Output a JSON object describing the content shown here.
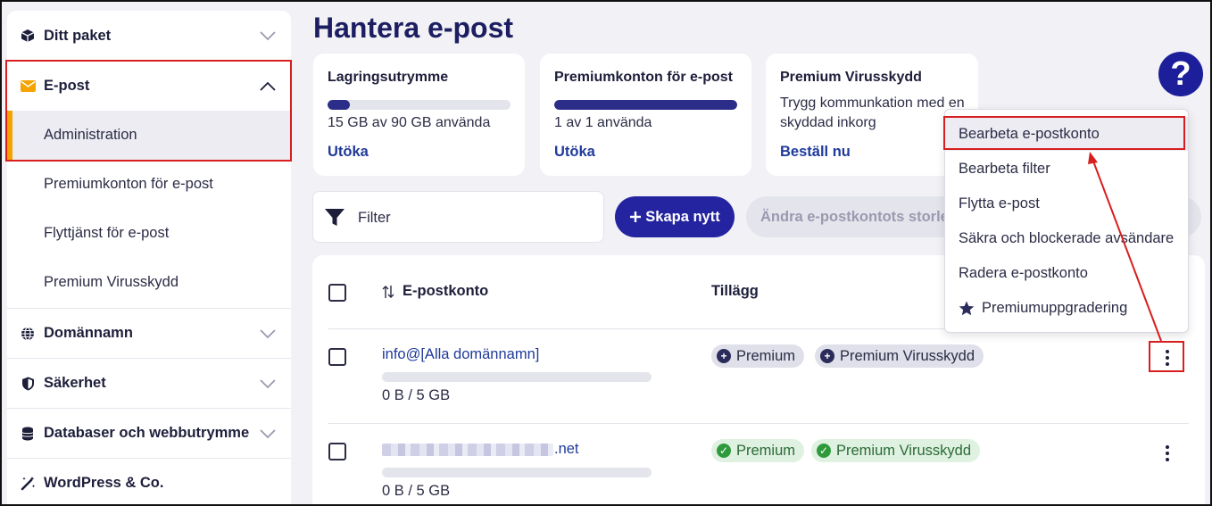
{
  "sidebar": {
    "items": [
      {
        "label": "Ditt paket",
        "icon": "box-icon",
        "expanded": false
      },
      {
        "label": "E-post",
        "icon": "envelope-icon",
        "expanded": true
      },
      {
        "label": "Domännamn",
        "icon": "globe-icon",
        "expanded": false
      },
      {
        "label": "Säkerhet",
        "icon": "shield-icon",
        "expanded": false
      },
      {
        "label": "Databaser och webbutrymme",
        "icon": "database-icon",
        "expanded": false
      },
      {
        "label": "WordPress & Co.",
        "icon": "magic-wand-icon",
        "expanded": false
      }
    ],
    "email_sub": [
      {
        "label": "Administration",
        "active": true
      },
      {
        "label": "Premiumkonton för e-post"
      },
      {
        "label": "Flyttjänst för e-post"
      },
      {
        "label": "Premium Virusskydd"
      }
    ]
  },
  "page": {
    "title": "Hantera e-post"
  },
  "cards": [
    {
      "title": "Lagringsutrymme",
      "progress": 0.12,
      "status": "15 GB av 90 GB använda",
      "link": "Utöka"
    },
    {
      "title": "Premiumkonton för e-post",
      "progress": 1.0,
      "status": "1 av 1 använda",
      "link": "Utöka"
    },
    {
      "title": "Premium Virusskydd",
      "description": "Trygg kommunkation med en skyddad inkorg",
      "link": "Beställ nu"
    }
  ],
  "toolbar": {
    "filter_label": "Filter",
    "create_label": "Skapa nytt",
    "resize_label": "Ändra e-postkontots storlek"
  },
  "table": {
    "headers": {
      "account": "E-postkonto",
      "addons": "Tillägg"
    },
    "rows": [
      {
        "email": "info@[Alla domännamn]",
        "usage": "0 B / 5 GB",
        "addons": [
          "Premium",
          "Premium Virusskydd"
        ],
        "addon_status": "available"
      },
      {
        "email_suffix": ".net",
        "usage": "0 B / 5 GB",
        "addons": [
          "Premium",
          "Premium Virusskydd"
        ],
        "addon_status": "active"
      }
    ]
  },
  "menu": {
    "items": [
      {
        "label": "Bearbeta e-postkonto",
        "highlighted": true
      },
      {
        "label": "Bearbeta filter"
      },
      {
        "label": "Flytta e-post"
      },
      {
        "label": "Säkra och blockerade avsändare"
      },
      {
        "label": "Radera e-postkonto"
      },
      {
        "label": "Premiumuppgradering",
        "icon": "star-icon"
      }
    ]
  },
  "help": {
    "glyph": "?"
  },
  "colors": {
    "accent": "#2424a0",
    "highlight_box": "#d81e1e",
    "active_bar": "#f5a300"
  }
}
